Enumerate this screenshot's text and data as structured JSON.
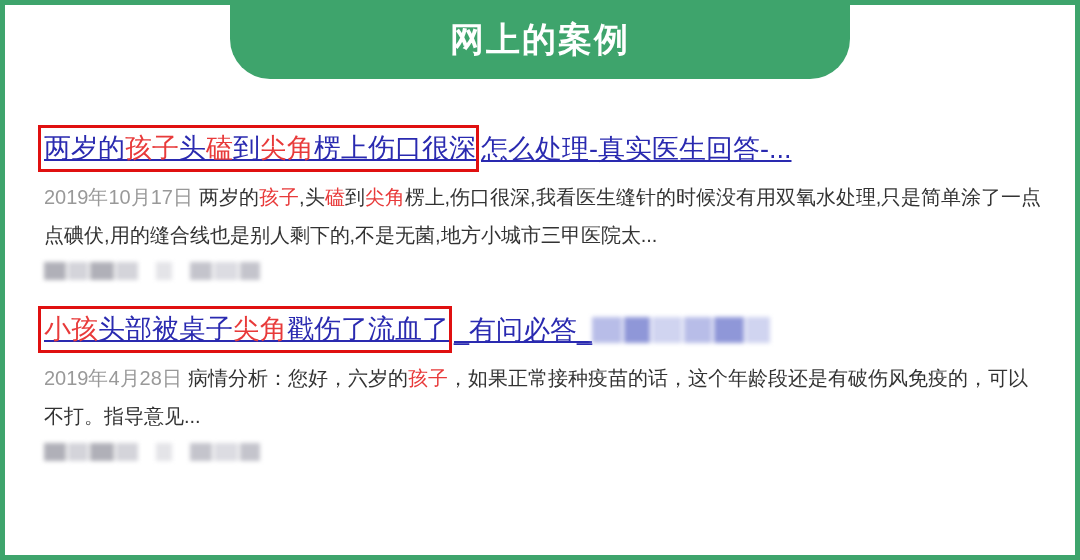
{
  "header": {
    "title": "网上的案例"
  },
  "results": [
    {
      "title_boxed": [
        {
          "text": "两岁的",
          "hit": false
        },
        {
          "text": "孩子",
          "hit": true
        },
        {
          "text": "头",
          "hit": false
        },
        {
          "text": "磕",
          "hit": true
        },
        {
          "text": "到",
          "hit": false
        },
        {
          "text": "尖角",
          "hit": true
        },
        {
          "text": "楞上伤口很深",
          "hit": false
        }
      ],
      "title_rest": [
        {
          "text": "怎么处理-真实医生回答-...",
          "hit": false
        }
      ],
      "title_blurred": false,
      "date": "2019年10月17日",
      "snippet": [
        {
          "text": "两岁的",
          "hit": false
        },
        {
          "text": "孩子",
          "hit": true
        },
        {
          "text": ",头",
          "hit": false
        },
        {
          "text": "磕",
          "hit": true
        },
        {
          "text": "到",
          "hit": false
        },
        {
          "text": "尖角",
          "hit": true
        },
        {
          "text": "楞上,伤口很深,我看医生缝针的时候没有用双氧水处理,只是简单涂了一点点碘伏,用的缝合线也是别人剩下的,不是无菌,地方小城市三甲医院太...",
          "hit": false
        }
      ]
    },
    {
      "title_boxed": [
        {
          "text": "小孩",
          "hit": true
        },
        {
          "text": "头部被桌子",
          "hit": false
        },
        {
          "text": "尖角",
          "hit": true
        },
        {
          "text": "戳伤了流血了",
          "hit": false
        }
      ],
      "title_rest": [
        {
          "text": "_有问必答_",
          "hit": false
        }
      ],
      "title_blurred": true,
      "date": "2019年4月28日",
      "snippet": [
        {
          "text": "病情分析：您好，六岁的",
          "hit": false
        },
        {
          "text": "孩子",
          "hit": true
        },
        {
          "text": "，如果正常接种疫苗的话，这个年龄段还是有破伤风免疫的，可以不打。指导意见...",
          "hit": false
        }
      ]
    }
  ]
}
